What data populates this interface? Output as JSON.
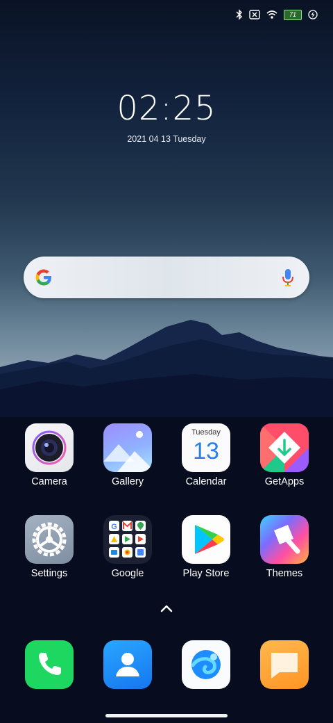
{
  "status_bar": {
    "icons": [
      "bluetooth-icon",
      "sim-off-icon",
      "wifi-icon",
      "battery-icon",
      "charging-icon"
    ],
    "battery_level": "71"
  },
  "clock": {
    "time": "02:25",
    "date": "2021 04 13 Tuesday"
  },
  "search_widget": {
    "logo": "google-g-icon",
    "mic": "mic-icon"
  },
  "apps": [
    {
      "label": "Camera",
      "icon": "camera-icon"
    },
    {
      "label": "Gallery",
      "icon": "gallery-icon"
    },
    {
      "label": "Calendar",
      "icon": "calendar-icon",
      "day_name": "Tuesday",
      "day_number": "13"
    },
    {
      "label": "GetApps",
      "icon": "getapps-icon"
    },
    {
      "label": "Settings",
      "icon": "settings-icon"
    },
    {
      "label": "Google",
      "icon": "google-folder-icon"
    },
    {
      "label": "Play Store",
      "icon": "play-store-icon"
    },
    {
      "label": "Themes",
      "icon": "themes-icon"
    }
  ],
  "dock": [
    {
      "icon": "phone-icon"
    },
    {
      "icon": "contacts-icon"
    },
    {
      "icon": "browser-icon"
    },
    {
      "icon": "messages-icon"
    }
  ],
  "colors": {
    "phone": "#1ed760",
    "contacts": "#1e8ef7",
    "messages": "#ffa733"
  }
}
